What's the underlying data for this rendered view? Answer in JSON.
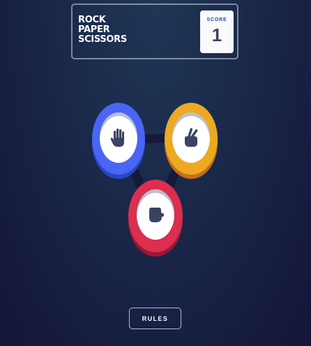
{
  "header": {
    "title_lines": [
      "ROCK",
      "PAPER",
      "SCISSORS"
    ],
    "score_label": "SCORE",
    "score_value": "1"
  },
  "tokens": [
    {
      "name": "paper",
      "color": "#4865f4",
      "icon": "hand-paper-icon"
    },
    {
      "name": "scissors",
      "color": "#eca922",
      "icon": "hand-scissors-icon"
    },
    {
      "name": "rock",
      "color": "#dc2e4e",
      "icon": "hand-rock-icon"
    }
  ],
  "footer": {
    "rules_label": "RULES"
  },
  "colors": {
    "background_top": "#1f3756",
    "background_bottom": "#141539",
    "connector": "#151a3a",
    "score_text": "#3b4363",
    "score_label": "#2a46c0"
  }
}
